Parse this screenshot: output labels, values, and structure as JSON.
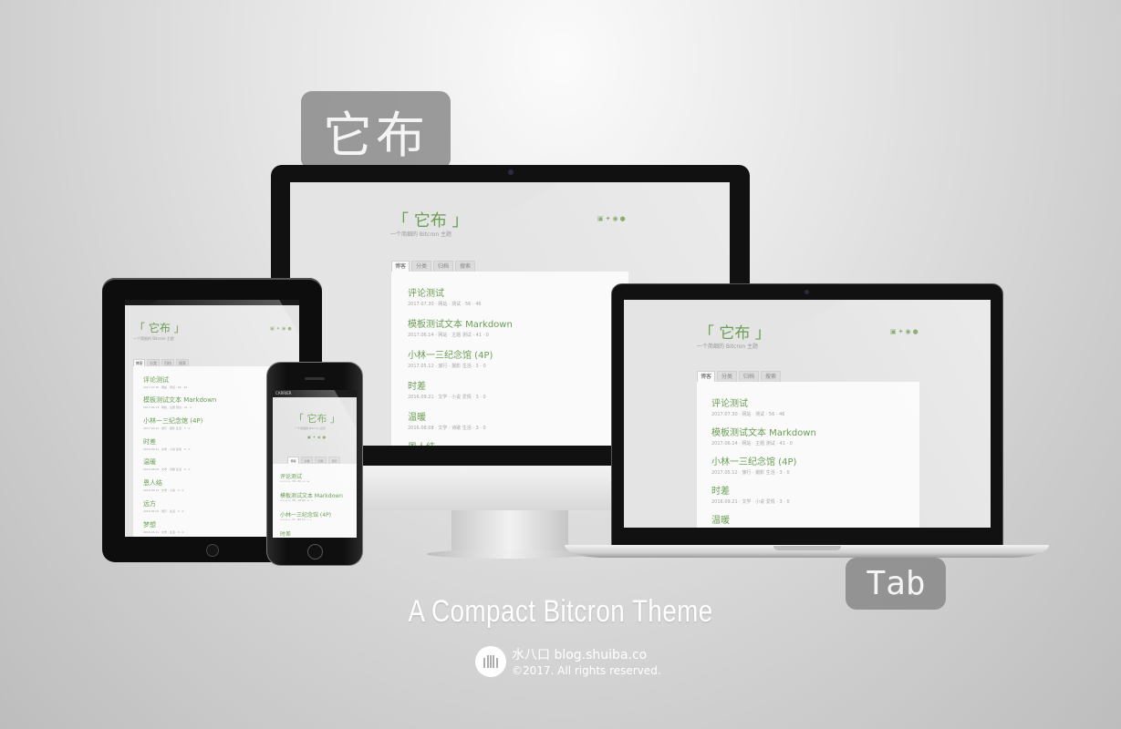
{
  "labels": {
    "desktop": "它布",
    "tablet": "Tab"
  },
  "site": {
    "title": "「 它布 」",
    "subtitle": "一个简细的 Bitcron 主题",
    "social_icons": [
      "instagram-icon",
      "twitter-icon",
      "weibo-icon",
      "github-icon"
    ],
    "tabs": [
      "博客",
      "分类",
      "归档",
      "搜索"
    ],
    "posts": [
      {
        "title": "评论测试",
        "meta": "2017.07.30 · 网站 · 测试 · 56 · 46"
      },
      {
        "title": "模板测试文本 Markdown",
        "meta": "2017.06.14 · 网站 · 主题 测试 · 41 · 0"
      },
      {
        "title": "小林一三纪念馆 (4P)",
        "meta": "2017.05.12 · 旅行 · 摄影 生活 · 3 · 0"
      },
      {
        "title": "时差",
        "meta": "2016.09.21 · 文学 · 小说 爱情 · 3 · 0"
      },
      {
        "title": "温暖",
        "meta": "2016.08.08 · 文学 · 诗歌 生活 · 3 · 0"
      },
      {
        "title": "恩人结",
        "meta": "2016.06.14 · 文学 · 小说 · 3 · 0"
      },
      {
        "title": "远方",
        "meta": "2016.05.02 · 旅行 · 生活 · 3 · 0"
      },
      {
        "title": "梦想",
        "meta": "2016.03.11 · 文学 · 生活 · 3 · 0"
      }
    ]
  },
  "phone": {
    "carrier": "CARRIER",
    "time": ""
  },
  "footer": {
    "title": "A Compact Bitcron Theme",
    "brand": "水八口 blog.shuiba.co",
    "copyright": "©2017. All rights reserved."
  }
}
